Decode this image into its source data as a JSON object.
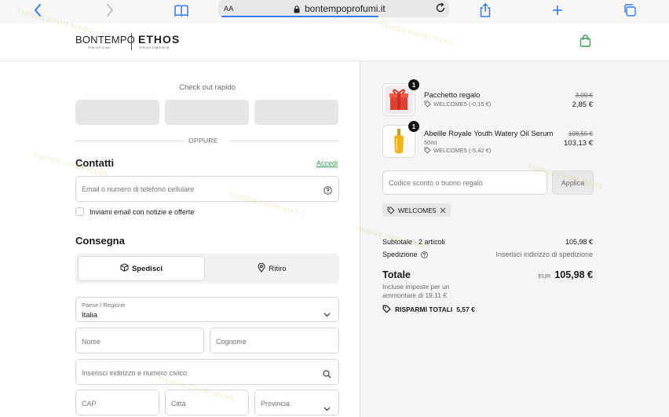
{
  "browser": {
    "text_size_label": "AA",
    "url": "bontempoprofumi.it"
  },
  "header": {
    "brand1": "BONTEMPO",
    "brand1_sub": "PROFUMI",
    "brand2": "ETHOS",
    "brand2_sub": "PROFUMERIE"
  },
  "express": {
    "title": "Check out rapido",
    "or_label": "OPPURE"
  },
  "contacts": {
    "title": "Contatti",
    "login_link": "Accedi",
    "email_placeholder": "Email o numero di telefono cellulare",
    "newsletter_label": "Inviami email con notizie e offerte"
  },
  "delivery": {
    "title": "Consegna",
    "ship_label": "Spedisci",
    "pickup_label": "Ritiro",
    "country_label": "Paese / Regione",
    "country_value": "Italia",
    "first_name": "Nome",
    "last_name": "Cognome",
    "address_placeholder": "Inserisci indirizzo e numero civico",
    "zip": "CAP",
    "city": "Città",
    "province": "Provincia"
  },
  "summary": {
    "items": [
      {
        "qty": "1",
        "name": "Pacchetto regalo",
        "variant": "",
        "discount": "WELCOME5 (-0,15 €)",
        "old_price": "3,00 €",
        "price": "2,85 €"
      },
      {
        "qty": "1",
        "name": "Abeille Royale Youth Watery Oil Serum",
        "variant": "50ml",
        "discount": "WELCOME5 (-5,42 €)",
        "old_price": "108,55 €",
        "price": "103,13 €"
      }
    ],
    "discount_placeholder": "Codice sconto o buono regalo",
    "apply_label": "Applica",
    "applied_code": "WELCOME5",
    "subtotal_label": "Subtotale · 2 articoli",
    "subtotal_value": "105,98 €",
    "shipping_label": "Spedizione",
    "shipping_value": "Inserisci indirizzo di spedizione",
    "total_label": "Totale",
    "currency": "EUR",
    "total_value": "105,98 €",
    "tax_note": "Incluse imposte per un ammontare di 19,11 €",
    "savings_label": "RISPARMI TOTALI",
    "savings_value": "5,57 €"
  },
  "watermark": "THINGS FROM MARS",
  "colors": {
    "accent_link": "#3a9b57",
    "safari_blue": "#2f7cf6",
    "summary_bg": "#f5f5f5"
  }
}
